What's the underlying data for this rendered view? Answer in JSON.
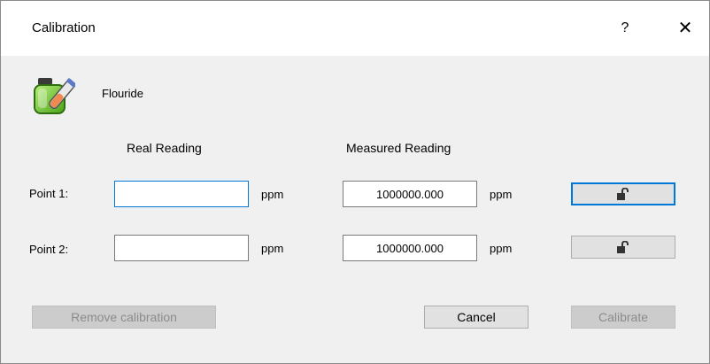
{
  "window": {
    "title": "Calibration",
    "help_label": "?",
    "close_label": "✕"
  },
  "element": {
    "icon": "chemical-bottle-icon",
    "name": "Flouride"
  },
  "columns": {
    "real": "Real Reading",
    "measured": "Measured Reading"
  },
  "points": [
    {
      "label": "Point 1:",
      "real_value": "",
      "real_unit": "ppm",
      "measured_value": "1000000.000",
      "measured_unit": "ppm",
      "lock_icon": "unlock-icon"
    },
    {
      "label": "Point 2:",
      "real_value": "",
      "real_unit": "ppm",
      "measured_value": "1000000.000",
      "measured_unit": "ppm",
      "lock_icon": "unlock-icon"
    }
  ],
  "buttons": {
    "remove_calibration": "Remove calibration",
    "cancel": "Cancel",
    "calibrate": "Calibrate"
  },
  "colors": {
    "accent": "#0078d7",
    "titlebar": "#ffffff",
    "body": "#f0f0f0"
  }
}
